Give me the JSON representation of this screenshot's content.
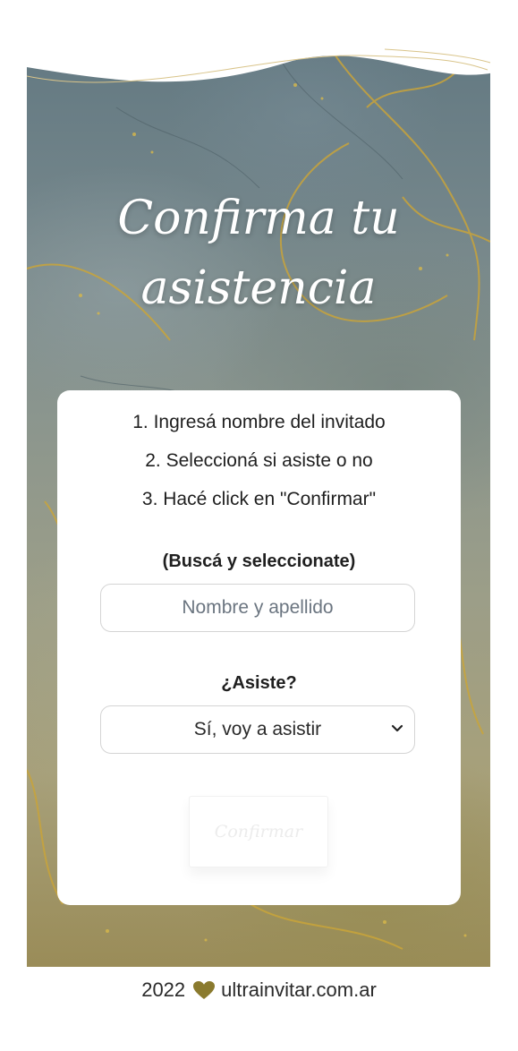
{
  "hero": {
    "title_line1": "Confirma tu",
    "title_line2": "asistencia"
  },
  "card": {
    "steps": [
      "1. Ingresá nombre del invitado",
      "2. Seleccioná si asiste o no",
      "3. Hacé click en \"Confirmar\""
    ],
    "search_label": "(Buscá y seleccionate)",
    "name_placeholder": "Nombre y apellido",
    "attend_label": "¿Asiste?",
    "attend_selected": "Sí, voy a asistir",
    "confirm_label": "Confirmar"
  },
  "footer": {
    "year": "2022",
    "site": "ultrainvitar.com.ar",
    "heart_icon": "heart-icon"
  },
  "colors": {
    "accent_gold": "#8a7a2e",
    "text": "#1f1f1f",
    "placeholder": "#6b7580"
  }
}
